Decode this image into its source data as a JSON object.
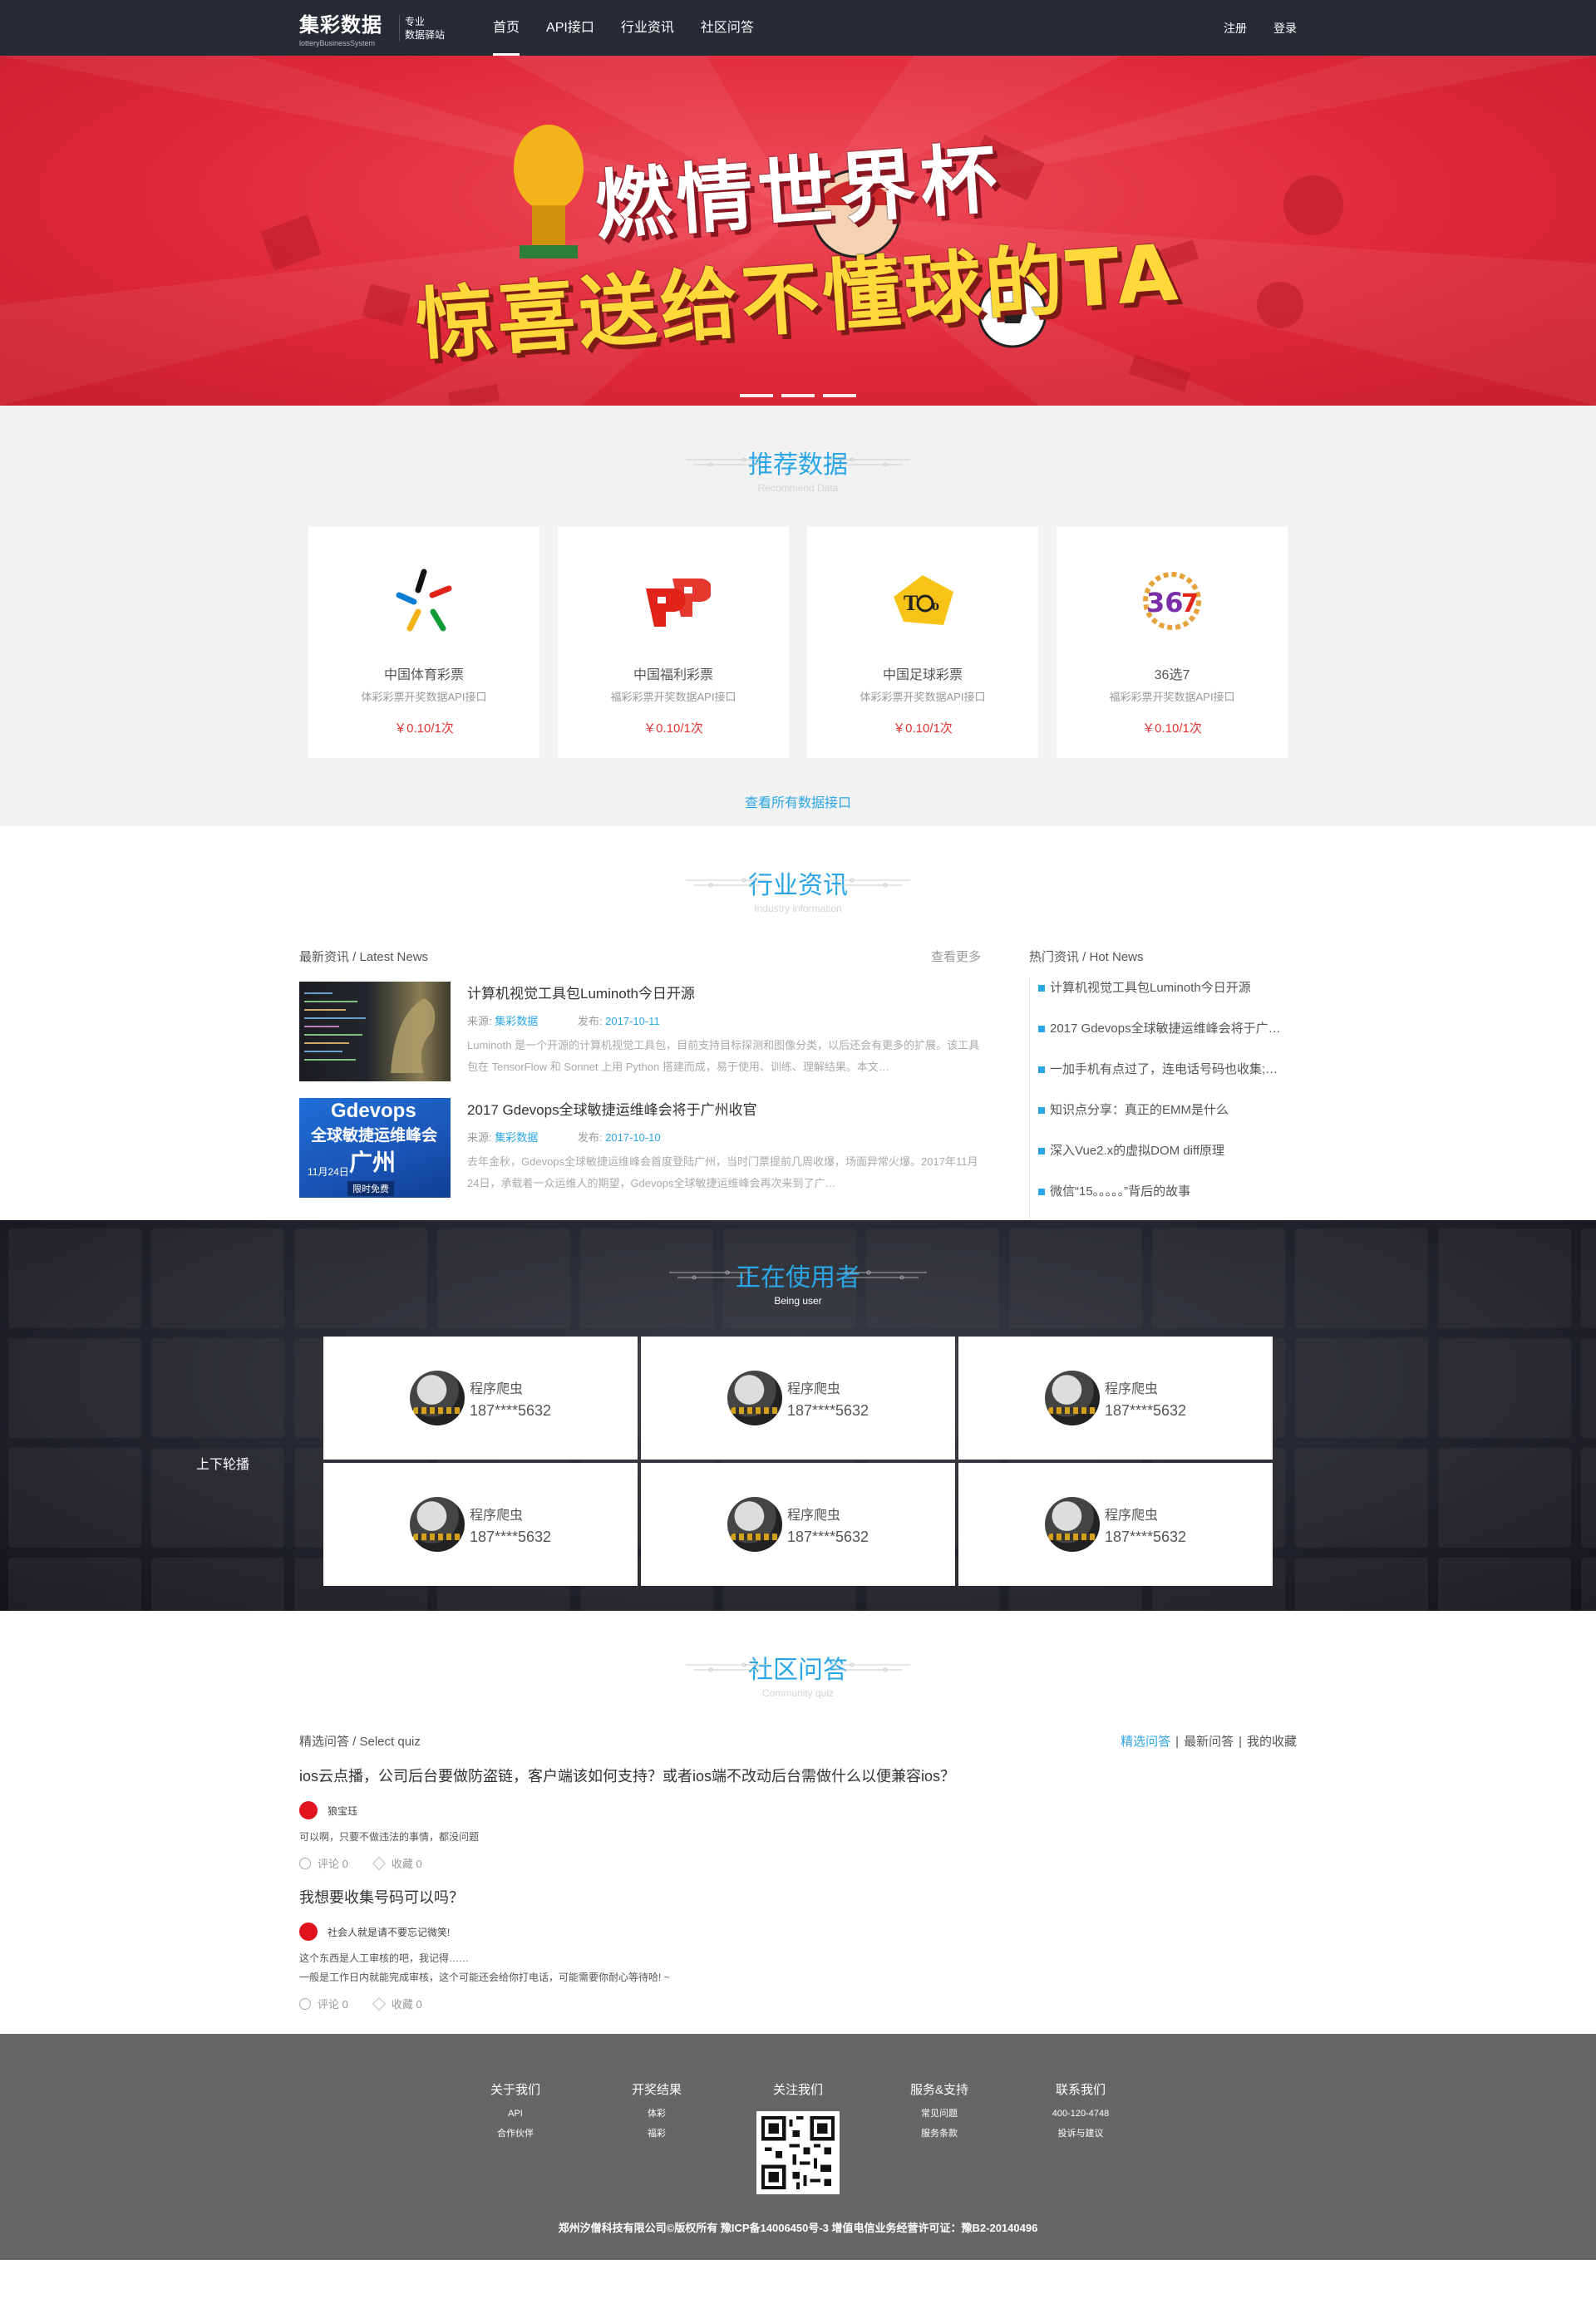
{
  "header": {
    "brand": "集彩数据",
    "brand_sub": "lotteryBusinessSystem",
    "slogan_line1": "专业",
    "slogan_line2": "数据驿站",
    "nav": [
      "首页",
      "API接口",
      "行业资讯",
      "社区问答"
    ],
    "register": "注册",
    "login": "登录"
  },
  "banner": {
    "line1": "燃情世界杯",
    "line2": "惊喜送给不懂球的TA",
    "slides": 3,
    "colors": {
      "bg": "#e0293a",
      "headline": "#ffffff",
      "accent": "#ffd93a"
    }
  },
  "recommend": {
    "title": "推荐数据",
    "subtitle": "Recommend Data",
    "cards": [
      {
        "name": "中国体育彩票",
        "desc": "体彩彩票开奖数据API接口",
        "price": "￥0.10/1次",
        "icon": "sports-lottery-logo-icon"
      },
      {
        "name": "中国福利彩票",
        "desc": "福彩彩票开奖数据API接口",
        "price": "￥0.10/1次",
        "icon": "welfare-lottery-logo-icon"
      },
      {
        "name": "中国足球彩票",
        "desc": "体彩彩票开奖数据API接口",
        "price": "￥0.10/1次",
        "icon": "toto-logo-icon"
      },
      {
        "name": "36选7",
        "desc": "福彩彩票开奖数据API接口",
        "price": "￥0.10/1次",
        "icon": "36-7-logo-icon"
      }
    ],
    "more": "查看所有数据接口"
  },
  "news": {
    "title": "行业资讯",
    "subtitle": "Industry information",
    "latest_label": "最新资讯 / Latest News",
    "more": "查看更多",
    "items": [
      {
        "title": "计算机视觉工具包Luminoth今日开源",
        "source_label": "来源:",
        "source": "集彩数据",
        "date_label": "发布:",
        "date": "2017-10-11",
        "abstract": "Luminoth 是一个开源的计算机视觉工具包，目前支持目标探测和图像分类，以后还会有更多的扩展。该工具包在 TensorFlow 和 Sonnet 上用 Python 搭建而成，易于使用、训练、理解结果。本文…"
      },
      {
        "title": "2017 Gdevops全球敏捷运维峰会将于广州收官",
        "source_label": "来源:",
        "source": "集彩数据",
        "date_label": "发布:",
        "date": "2017-10-10",
        "abstract": "去年金秋，Gdevops全球敏捷运维峰会首度登陆广州，当时门票提前几周收爆，场面异常火爆。2017年11月24日，承载着一众运维人的期望，Gdevops全球敏捷运维峰会再次来到了广…"
      }
    ],
    "hot_label": "热门资讯 / Hot News",
    "hot": [
      "计算机视觉工具包Luminoth今日开源",
      "2017 Gdevops全球敏捷运维峰会将于广…",
      "一加手机有点过了，连电话号码也收集;…",
      "知识点分享：真正的EMM是什么",
      "深入Vue2.x的虚拟DOM diff原理",
      "微信“15。。。。。”背后的故事"
    ],
    "img2_title": "Gdevops",
    "img2_line": "全球敏捷运维峰会",
    "img2_city": "广州",
    "img2_date": "11月24日",
    "img2_badge": "限时免费"
  },
  "users": {
    "title": "正在使用者",
    "subtitle": "Being user",
    "carousel_label": "上下轮播",
    "list": [
      {
        "name": "程序爬虫",
        "phone": "187****5632"
      },
      {
        "name": "程序爬虫",
        "phone": "187****5632"
      },
      {
        "name": "程序爬虫",
        "phone": "187****5632"
      },
      {
        "name": "程序爬虫",
        "phone": "187****5632"
      },
      {
        "name": "程序爬虫",
        "phone": "187****5632"
      },
      {
        "name": "程序爬虫",
        "phone": "187****5632"
      }
    ]
  },
  "community": {
    "title": "社区问答",
    "subtitle": "Community quiz",
    "select_label": "精选问答 / Select quiz",
    "tabs": [
      "精选问答",
      "最新问答",
      "我的收藏"
    ],
    "questions": [
      {
        "q": "ios云点播，公司后台要做防盗链，客户端该如何支持？或者ios端不改动后台需做什么以便兼容ios？",
        "user": "狼宝珏",
        "lines": [
          "可以啊，只要不做违法的事情，都没问题"
        ],
        "comments": "评论 0",
        "favs": "收藏 0"
      },
      {
        "q": "我想要收集号码可以吗？",
        "user": "社会人就是请不要忘记微笑!",
        "lines": [
          "这个东西是人工审核的吧，我记得……",
          "一般是工作日内就能完成审核，这个可能还会给你打电话，可能需要你耐心等待哈! ~"
        ],
        "comments": "评论 0",
        "favs": "收藏 0"
      }
    ]
  },
  "footer": {
    "cols": [
      {
        "h": "关于我们",
        "links": [
          "API",
          "合作伙伴"
        ]
      },
      {
        "h": "开奖结果",
        "links": [
          "体彩",
          "福彩"
        ]
      },
      {
        "h": "关注我们",
        "links": []
      },
      {
        "h": "服务&支持",
        "links": [
          "常见问题",
          "服务条款"
        ]
      },
      {
        "h": "联系我们",
        "links": [
          "400-120-4748",
          "投诉与建议"
        ]
      }
    ],
    "copyright": "郑州汐僧科技有限公司©版权所有    豫ICP备14006450号-3    增值电信业务经营许可证：豫B2-20140496"
  }
}
